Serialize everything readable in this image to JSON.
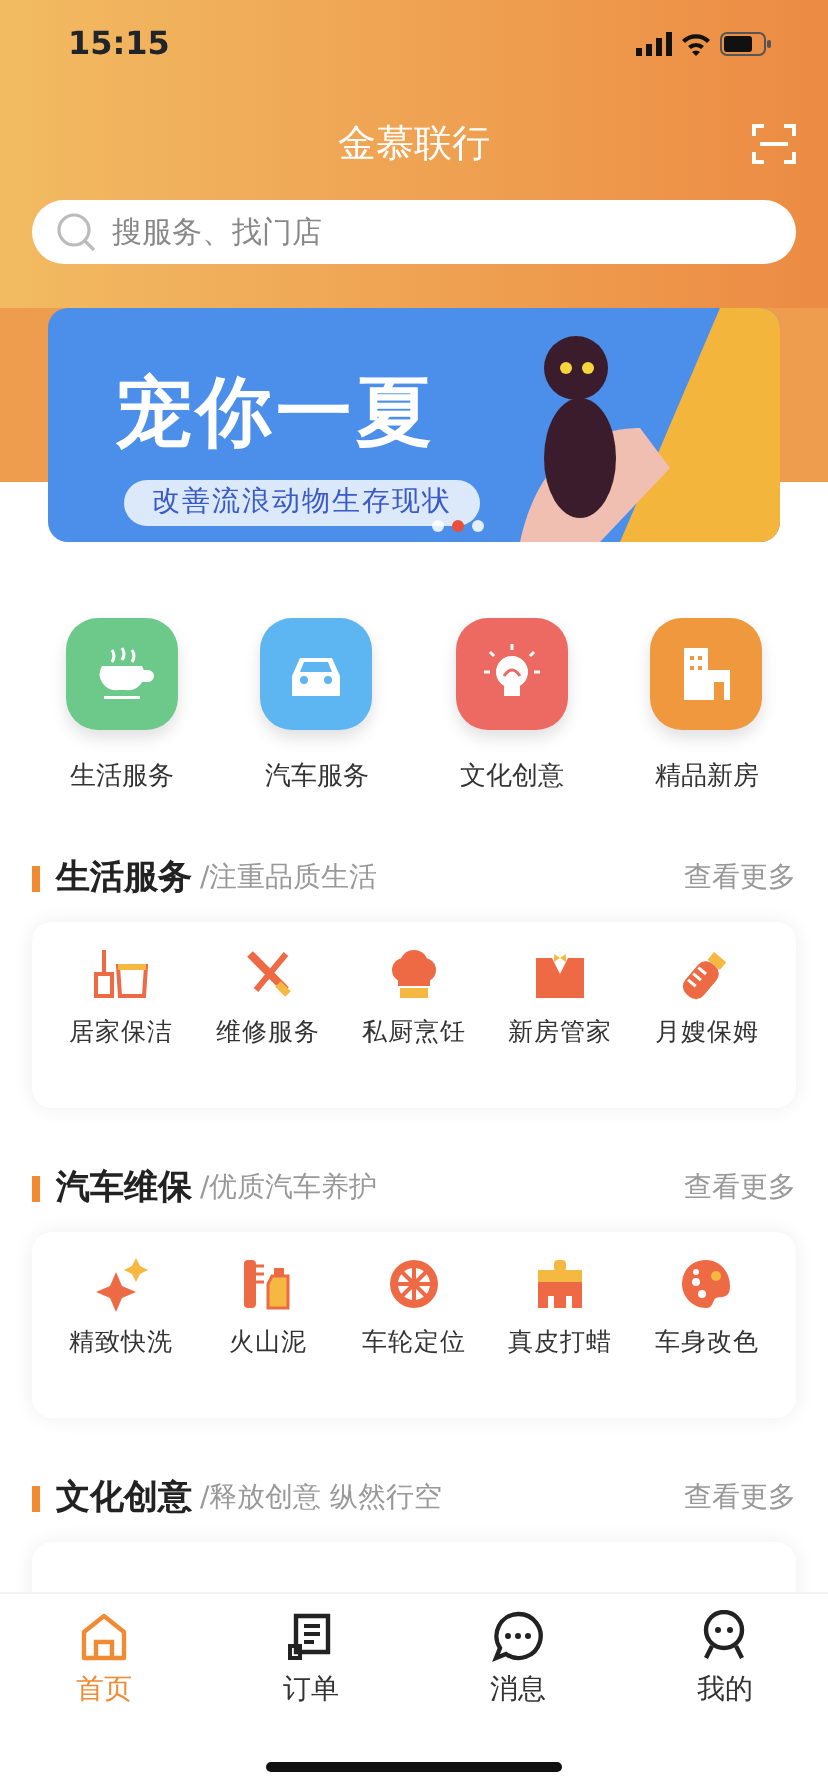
{
  "status_bar": {
    "time": "15:15"
  },
  "header": {
    "title": "金慕联行"
  },
  "search": {
    "placeholder": "搜服务、找门店"
  },
  "banner": {
    "headline": "宠你一夏",
    "caption": "改善流浪动物生存现状",
    "dots": [
      {
        "selected": false
      },
      {
        "selected": true
      },
      {
        "selected": false
      }
    ]
  },
  "categories": [
    {
      "label": "生活服务",
      "color": "#6cc98a"
    },
    {
      "label": "汽车服务",
      "color": "#5db5f2"
    },
    {
      "label": "文化创意",
      "color": "#ec6a62"
    },
    {
      "label": "精品新房",
      "color": "#f0983e"
    }
  ],
  "sections": [
    {
      "title": "生活服务",
      "subtitle": "/注重品质生活",
      "more": "查看更多",
      "items": [
        "居家保洁",
        "维修服务",
        "私厨烹饪",
        "新房管家",
        "月嫂保姆"
      ]
    },
    {
      "title": "汽车维保",
      "subtitle": "/优质汽车养护",
      "more": "查看更多",
      "items": [
        "精致快洗",
        "火山泥",
        "车轮定位",
        "真皮打蜡",
        "车身改色"
      ]
    },
    {
      "title": "文化创意",
      "subtitle": "/释放创意 纵然行空",
      "more": "查看更多"
    }
  ],
  "tab_bar": [
    {
      "label": "首页",
      "selected": true
    },
    {
      "label": "订单",
      "selected": false
    },
    {
      "label": "消息",
      "selected": false
    },
    {
      "label": "我的",
      "selected": false
    }
  ]
}
